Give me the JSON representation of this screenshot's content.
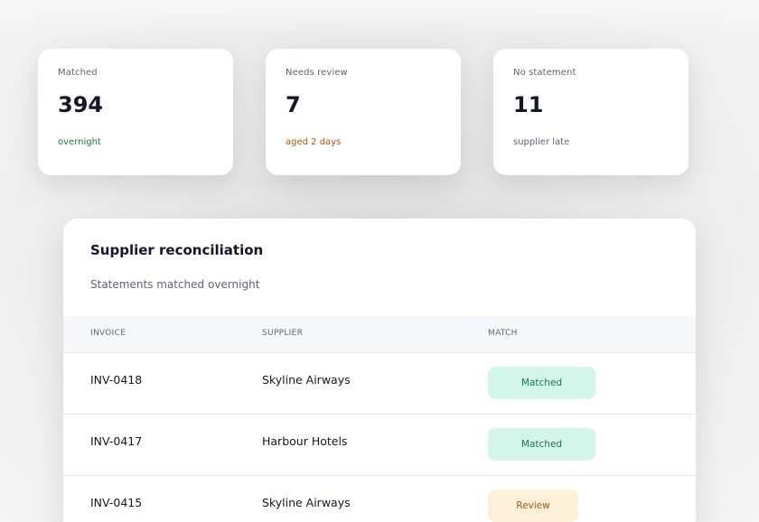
{
  "stats": [
    {
      "label": "Matched",
      "value": "394",
      "note": "overnight",
      "note_color": "#15803d"
    },
    {
      "label": "Needs review",
      "value": "7",
      "note": "aged 2 days",
      "note_color": "#b45309"
    },
    {
      "label": "No statement",
      "value": "11",
      "note": "supplier late",
      "note_color": "#5b6478"
    }
  ],
  "reconciliation": {
    "title": "Supplier reconciliation",
    "subtitle": "Statements matched overnight",
    "columns": {
      "invoice": "INVOICE",
      "supplier": "SUPPLIER",
      "match": "MATCH"
    },
    "rows": [
      {
        "invoice": "INV-0418",
        "supplier": "Skyline Airways",
        "match": "Matched",
        "status": "matched"
      },
      {
        "invoice": "INV-0417",
        "supplier": "Harbour Hotels",
        "match": "Matched",
        "status": "matched"
      },
      {
        "invoice": "INV-0415",
        "supplier": "Skyline Airways",
        "match": "Review",
        "status": "review"
      }
    ]
  },
  "colors": {
    "matched_badge_bg": "#d4f5ea",
    "matched_badge_text": "#157a56",
    "review_badge_bg": "#fdf0d9",
    "review_badge_text": "#a35a0c"
  }
}
